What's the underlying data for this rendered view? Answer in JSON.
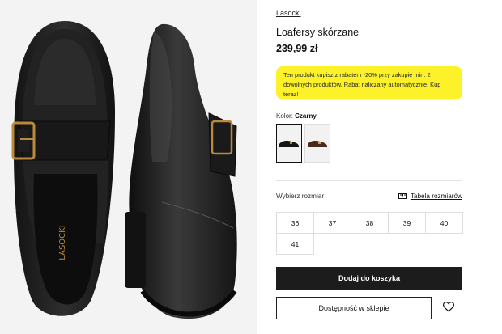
{
  "product": {
    "brand": "Lasocki",
    "title": "Loafersy skórzane",
    "price": "239,99 zł",
    "shoe_logo": "LASOCKI"
  },
  "promo": {
    "text": "Ten produkt kupisz z rabatem -20% przy zakupie min. 2 dowolnych produktów. Rabat naliczany automatycznie. Kup teraz!",
    "color": "#fdf22a"
  },
  "color_select": {
    "label": "Kolor:",
    "value": "Czarny",
    "swatches": [
      "black-loafer",
      "brown-loafer"
    ]
  },
  "size_select": {
    "label": "Wybierz rozmiar:",
    "table_link": "Tabela rozmiarów",
    "sizes": [
      "36",
      "37",
      "38",
      "39",
      "40",
      "41"
    ]
  },
  "actions": {
    "add_to_cart": "Dodaj do koszyka",
    "store_availability": "Dostępność w sklepie",
    "wishlist_icon": "heart-icon"
  },
  "colors": {
    "button_dark": "#1c1c1c",
    "gallery_bg": "#f3f3f3"
  }
}
